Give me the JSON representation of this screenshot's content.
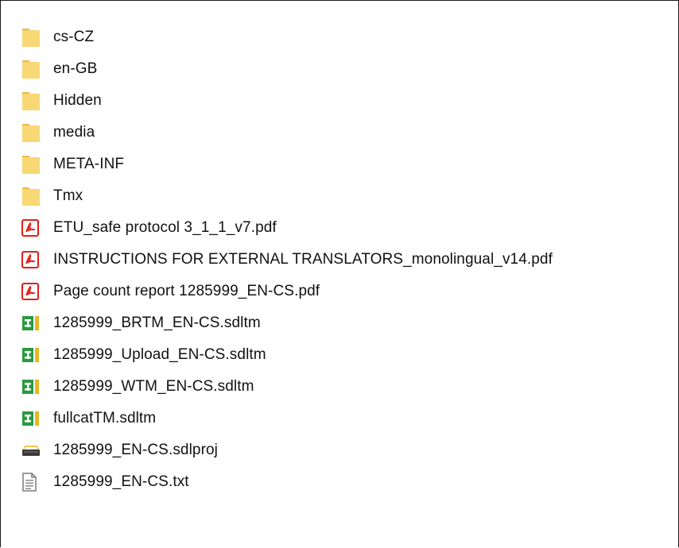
{
  "files": [
    {
      "name": "cs-CZ",
      "icon": "folder-icon"
    },
    {
      "name": "en-GB",
      "icon": "folder-icon"
    },
    {
      "name": "Hidden",
      "icon": "folder-icon"
    },
    {
      "name": "media",
      "icon": "folder-icon"
    },
    {
      "name": "META-INF",
      "icon": "folder-icon"
    },
    {
      "name": "Tmx",
      "icon": "folder-icon"
    },
    {
      "name": "ETU_safe protocol 3_1_1_v7.pdf",
      "icon": "pdf-icon"
    },
    {
      "name": "INSTRUCTIONS FOR EXTERNAL TRANSLATORS_monolingual_v14.pdf",
      "icon": "pdf-icon"
    },
    {
      "name": "Page count report 1285999_EN-CS.pdf",
      "icon": "pdf-icon"
    },
    {
      "name": "1285999_BRTM_EN-CS.sdltm",
      "icon": "sdltm-icon"
    },
    {
      "name": "1285999_Upload_EN-CS.sdltm",
      "icon": "sdltm-icon"
    },
    {
      "name": "1285999_WTM_EN-CS.sdltm",
      "icon": "sdltm-icon"
    },
    {
      "name": "fullcatTM.sdltm",
      "icon": "sdltm-icon"
    },
    {
      "name": "1285999_EN-CS.sdlproj",
      "icon": "sdlproj-icon"
    },
    {
      "name": "1285999_EN-CS.txt",
      "icon": "text-file-icon"
    }
  ],
  "colors": {
    "folder": "#f8d775",
    "folder_dark": "#e9b949",
    "pdf": "#e0201b",
    "sdltm_green": "#2a9a3f",
    "sdltm_yellow": "#e9b720",
    "text": "#111111",
    "border": "#1a1a1a"
  }
}
